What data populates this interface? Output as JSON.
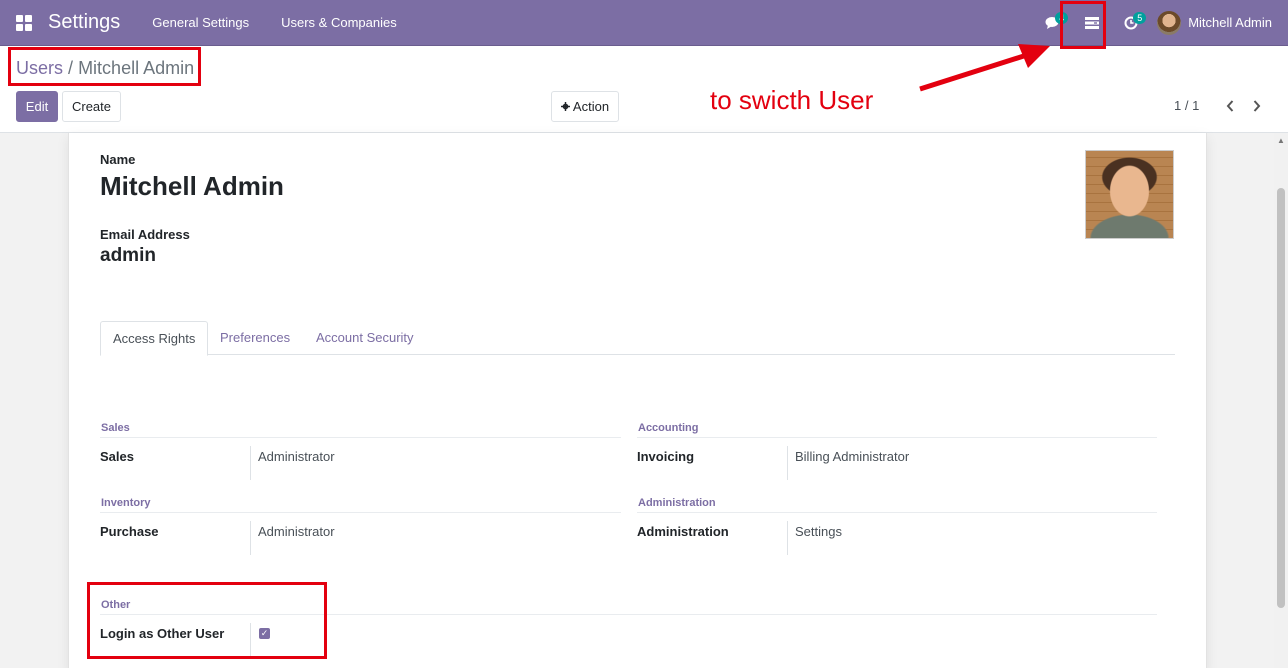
{
  "navbar": {
    "brand": "Settings",
    "menus": [
      "General Settings",
      "Users & Companies"
    ],
    "messages_badge": "4",
    "activities_badge": "5",
    "user_name": "Mitchell Admin"
  },
  "breadcrumb": {
    "parent": "Users",
    "separator": "/",
    "current": "Mitchell Admin"
  },
  "control_panel": {
    "edit_label": "Edit",
    "create_label": "Create",
    "action_label": "Action",
    "pager": "1 / 1"
  },
  "annotation": {
    "text": "to swicth User",
    "color": "#e3000f"
  },
  "form": {
    "name_label": "Name",
    "name_value": "Mitchell Admin",
    "email_label": "Email Address",
    "email_value": "admin",
    "tabs": [
      "Access Rights",
      "Preferences",
      "Account Security"
    ],
    "groups": {
      "sales": {
        "title": "Sales",
        "field_label": "Sales",
        "field_value": "Administrator"
      },
      "accounting": {
        "title": "Accounting",
        "field_label": "Invoicing",
        "field_value": "Billing Administrator"
      },
      "inventory": {
        "title": "Inventory",
        "field_label": "Purchase",
        "field_value": "Administrator"
      },
      "administration": {
        "title": "Administration",
        "field_label": "Administration",
        "field_value": "Settings"
      },
      "other": {
        "title": "Other",
        "field_label": "Login as Other User",
        "checked": true
      }
    }
  },
  "colors": {
    "brand": "#7c6ea4",
    "badge": "#00a09d",
    "annotation": "#e3000f"
  }
}
